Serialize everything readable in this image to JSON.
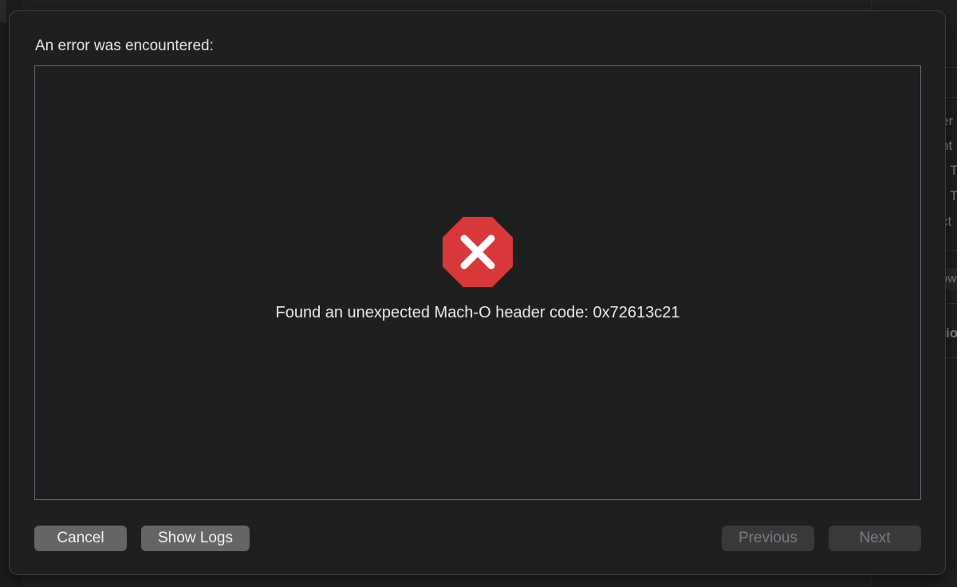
{
  "background": {
    "right_panel_fragments": [
      "er",
      "nt",
      "T",
      "T",
      "ct",
      "ow",
      "io"
    ]
  },
  "dialog": {
    "title": "An error was encountered:",
    "error_icon": "error-octagon-x-icon",
    "error_color": "#d8383a",
    "message": "Found an unexpected Mach-O header code: 0x72613c21"
  },
  "buttons": {
    "cancel": "Cancel",
    "show_logs": "Show Logs",
    "previous": "Previous",
    "next": "Next"
  }
}
